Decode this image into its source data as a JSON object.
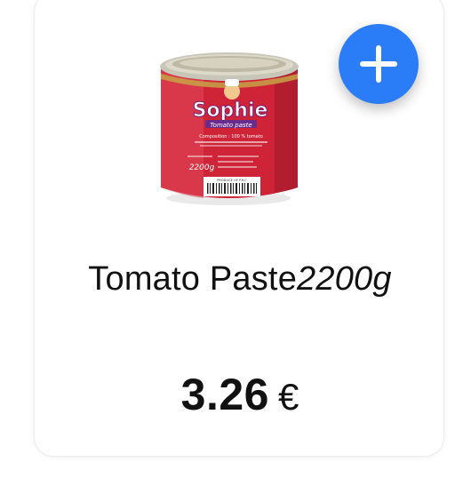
{
  "product": {
    "name": "Tomato Paste",
    "weight": "2200g",
    "price": "3.26",
    "currency": "€",
    "image": {
      "brand": "Sophie",
      "line": "Tomato paste",
      "composition": "Composition : 100 % tomato",
      "weight_label": "2200g",
      "barcode_caption": "PRODUCE OF P.R.C"
    }
  },
  "actions": {
    "add_icon": "plus-icon"
  },
  "colors": {
    "accent": "#2A7DF6",
    "can_red": "#D0233A",
    "text": "#111111"
  }
}
